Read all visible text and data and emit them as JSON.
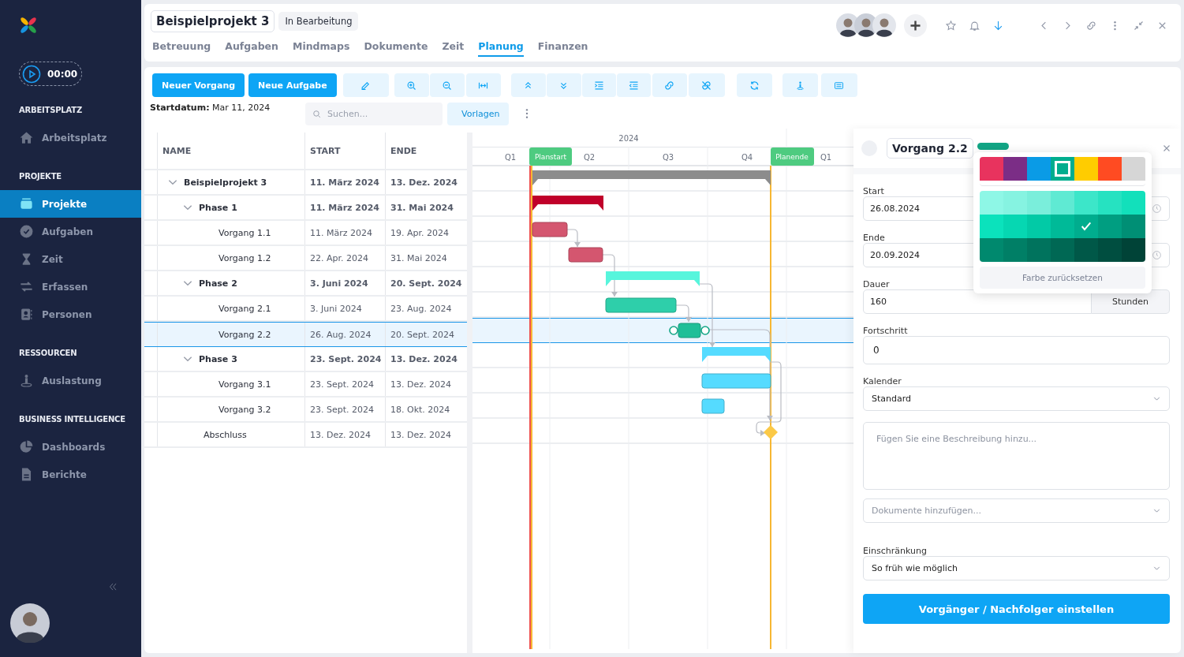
{
  "sidebar": {
    "timer": "00:00",
    "sections": [
      {
        "title": "ARBEITSPLATZ",
        "items": [
          {
            "label": "Arbeitsplatz",
            "selected": false
          }
        ]
      },
      {
        "title": "PROJEKTE",
        "items": [
          {
            "label": "Projekte",
            "selected": true
          },
          {
            "label": "Aufgaben",
            "selected": false
          },
          {
            "label": "Zeit",
            "selected": false
          },
          {
            "label": "Erfassen",
            "selected": false
          },
          {
            "label": "Personen",
            "selected": false
          }
        ]
      },
      {
        "title": "RESSOURCEN",
        "items": [
          {
            "label": "Auslastung",
            "selected": false
          }
        ]
      },
      {
        "title": "BUSINESS INTELLIGENCE",
        "items": [
          {
            "label": "Dashboards",
            "selected": false
          },
          {
            "label": "Berichte",
            "selected": false
          }
        ]
      }
    ]
  },
  "header": {
    "title": "Beispielprojekt 3",
    "status": "In Bearbeitung",
    "tabs": [
      {
        "label": "Betreuung",
        "selected": false
      },
      {
        "label": "Aufgaben",
        "selected": false
      },
      {
        "label": "Mindmaps",
        "selected": false
      },
      {
        "label": "Dokumente",
        "selected": false
      },
      {
        "label": "Zeit",
        "selected": false
      },
      {
        "label": "Planung",
        "selected": true
      },
      {
        "label": "Finanzen",
        "selected": false
      }
    ]
  },
  "toolbar": {
    "buttons": [
      "Neuer Vorgang",
      "Neue Aufgabe"
    ],
    "start_date": "**Startdatum:** Mar 11, 2024",
    "search": {
      "placeholder": "Suchen..."
    },
    "templates_button": "Vorlagen"
  },
  "table": {
    "columns": [
      "NAME",
      "START",
      "ENDE"
    ],
    "rows": [
      {
        "name": "Beispielprojekt 3",
        "start": "11. März 2024",
        "end": "13. Dez. 2024",
        "kind": "summary",
        "color": "#8c8c8c",
        "expanded": true,
        "selected": false,
        "children": [
          {
            "name": "Phase 1",
            "start": "11. März 2024",
            "end": "31. Mai 2024",
            "kind": "summary",
            "color": "#c0002a",
            "expanded": true,
            "selected": false,
            "children": [
              {
                "name": "Vorgang 1.1",
                "start": "11. März 2024",
                "end": "19. Apr. 2024",
                "kind": "task",
                "color": "#d4566f",
                "selected": false
              },
              {
                "name": "Vorgang 1.2",
                "start": "22. Apr. 2024",
                "end": "31. Mai 2024",
                "kind": "task",
                "color": "#d4566f",
                "selected": false
              }
            ]
          },
          {
            "name": "Phase 2",
            "start": "3. Juni 2024",
            "end": "20. Sept. 2024",
            "kind": "summary",
            "color": "#57f5dc",
            "expanded": true,
            "selected": false,
            "children": [
              {
                "name": "Vorgang 2.1",
                "start": "3. Juni 2024",
                "end": "23. Aug. 2024",
                "kind": "task",
                "color": "#2ecfaa",
                "selected": false
              },
              {
                "name": "Vorgang 2.2",
                "start": "26. Aug. 2024",
                "end": "20. Sept. 2024",
                "kind": "task",
                "color": "#1fbf98",
                "selected": true
              }
            ]
          },
          {
            "name": "Phase 3",
            "start": "23. Sept. 2024",
            "end": "13. Dez. 2024",
            "kind": "summary",
            "color": "#55dbff",
            "expanded": true,
            "selected": false,
            "children": [
              {
                "name": "Vorgang 3.1",
                "start": "23. Sept. 2024",
                "end": "13. Dez. 2024",
                "kind": "task",
                "color": "#55dbff",
                "selected": false
              },
              {
                "name": "Vorgang 3.2",
                "start": "23. Sept. 2024",
                "end": "18. Okt. 2024",
                "kind": "task",
                "color": "#55dbff",
                "selected": false
              }
            ]
          },
          {
            "name": "Abschluss",
            "start": "13. Dez. 2024",
            "end": "13. Dez. 2024",
            "kind": "milestone",
            "color": "#fbc947",
            "selected": false
          }
        ]
      }
    ]
  },
  "timeline": {
    "year": "2024",
    "quarters": [
      "Q1",
      "Q2",
      "Q3",
      "Q4",
      "Q1"
    ],
    "plan_start": "Planstart",
    "plan_end": "Planende"
  },
  "panel": {
    "title": "Vorgang 2.2",
    "color": "#12a585",
    "fields": [
      {
        "kind": "date",
        "label": "Start",
        "value": "26.08.2024"
      },
      {
        "kind": "date",
        "label": "Ende",
        "value": "20.09.2024"
      },
      {
        "kind": "unit",
        "label": "Dauer",
        "value": "160",
        "unit": "Stunden"
      },
      {
        "kind": "text",
        "label": "Fortschritt",
        "value": "0"
      },
      {
        "kind": "select",
        "label": "Kalender",
        "value": "Standard"
      },
      {
        "kind": "textarea",
        "placeholder": "Fügen Sie eine Beschreibung hinzu..."
      },
      {
        "kind": "select",
        "placeholder": "Dokumente hinzufügen..."
      },
      {
        "kind": "select",
        "label": "Einschränkung",
        "value": "So früh wie möglich"
      }
    ],
    "action_button": "Vorgänger / Nachfolger einstellen",
    "color_picker": {
      "palette": [
        {
          "color": "#e8335e",
          "selected": false
        },
        {
          "color": "#7b2d86",
          "selected": false
        },
        {
          "color": "#0a9be6",
          "selected": false
        },
        {
          "color": "#00ad8e",
          "selected": true
        },
        {
          "color": "#ffcc00",
          "selected": false
        },
        {
          "color": "#ff4b22",
          "selected": false
        },
        {
          "color": "#d6d6d6",
          "selected": false
        }
      ],
      "shades": [
        {
          "color": "#8ef7e6",
          "selected": false
        },
        {
          "color": "#86f3e1",
          "selected": false
        },
        {
          "color": "#7aeedb",
          "selected": false
        },
        {
          "color": "#5fead3",
          "selected": false
        },
        {
          "color": "#3ce6c9",
          "selected": false
        },
        {
          "color": "#26e2c1",
          "selected": false
        },
        {
          "color": "#12e0bb",
          "selected": false
        },
        {
          "color": "#0be2bc",
          "selected": false
        },
        {
          "color": "#06d7b2",
          "selected": false
        },
        {
          "color": "#02caa6",
          "selected": false
        },
        {
          "color": "#00ba98",
          "selected": false
        },
        {
          "color": "#00ad8e",
          "selected": true
        },
        {
          "color": "#009e81",
          "selected": false
        },
        {
          "color": "#008f75",
          "selected": false
        },
        {
          "color": "#00896e",
          "selected": false
        },
        {
          "color": "#007f66",
          "selected": false
        },
        {
          "color": "#00735d",
          "selected": false
        },
        {
          "color": "#006854",
          "selected": false
        },
        {
          "color": "#005848",
          "selected": false
        },
        {
          "color": "#004e40",
          "selected": false
        },
        {
          "color": "#004337",
          "selected": false
        }
      ],
      "reset_button": "Farbe zurücksetzen"
    }
  }
}
